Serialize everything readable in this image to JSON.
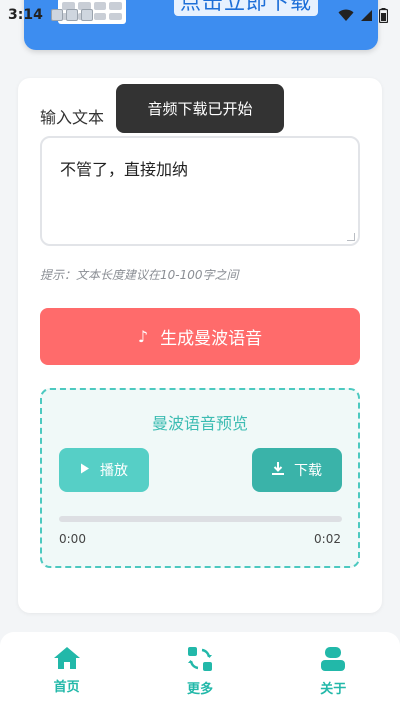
{
  "status_bar": {
    "time": "3:14"
  },
  "banner": {
    "cta_text": "点击立即下载"
  },
  "form": {
    "input_label": "输入文本",
    "input_value": "不管了，直接加纳",
    "hint": "提示：文本长度建议在10-100字之间",
    "generate_label": "生成曼波语音",
    "generate_icon": "♪"
  },
  "preview": {
    "title": "曼波语音预览",
    "play_label": "播放",
    "download_label": "下载",
    "progress": 0,
    "current_time": "0:00",
    "total_time": "0:02"
  },
  "toast": {
    "message": "音频下载已开始"
  },
  "nav": {
    "items": [
      {
        "label": "首页",
        "icon": "home-icon"
      },
      {
        "label": "更多",
        "icon": "more-icon"
      },
      {
        "label": "关于",
        "icon": "user-icon"
      }
    ]
  },
  "colors": {
    "accent_red": "#ff6b6b",
    "accent_teal": "#4cc9c0",
    "banner_blue": "#3d8df0"
  }
}
